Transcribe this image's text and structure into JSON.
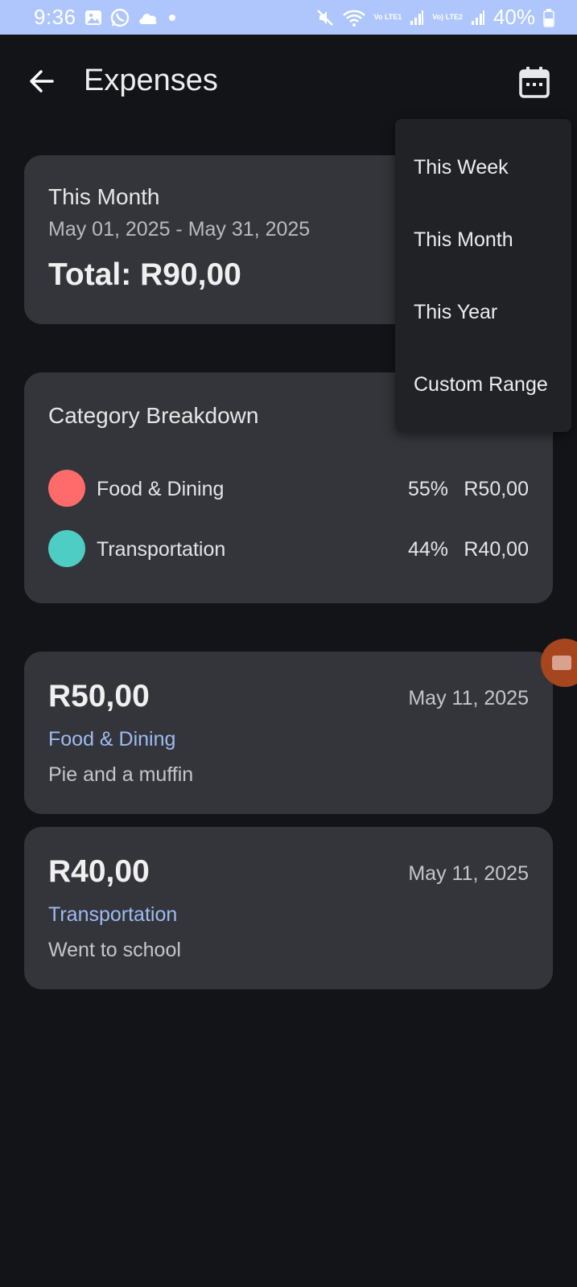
{
  "status_bar": {
    "time": "9:36",
    "network_1": "Vo LTE1",
    "network_2": "Vo) LTE2",
    "battery": "40%"
  },
  "app_bar": {
    "title": "Expenses",
    "back_icon": "arrow-left-icon",
    "calendar_icon": "calendar-icon"
  },
  "summary": {
    "period": "This Month",
    "range": "May 01, 2025 - May 31, 2025",
    "total": "Total: R90,00"
  },
  "breakdown": {
    "title": "Category Breakdown",
    "items": [
      {
        "name": "Food & Dining",
        "percent": "55%",
        "amount": "R50,00",
        "color": "#ff6b6b"
      },
      {
        "name": "Transportation",
        "percent": "44%",
        "amount": "R40,00",
        "color": "#4ecdc4"
      }
    ]
  },
  "expenses": [
    {
      "amount": "R50,00",
      "date": "May 11, 2025",
      "category": "Food & Dining",
      "description": "Pie and a muffin"
    },
    {
      "amount": "R40,00",
      "date": "May 11, 2025",
      "category": "Transportation",
      "description": "Went to school"
    }
  ],
  "period_menu": {
    "options": [
      "This Week",
      "This Month",
      "This Year",
      "Custom Range"
    ]
  },
  "colors": {
    "background": "#131418",
    "card": "#34353a",
    "menu": "#212226",
    "status_bar": "#aec6fb",
    "category_link": "#9ebbf2"
  }
}
